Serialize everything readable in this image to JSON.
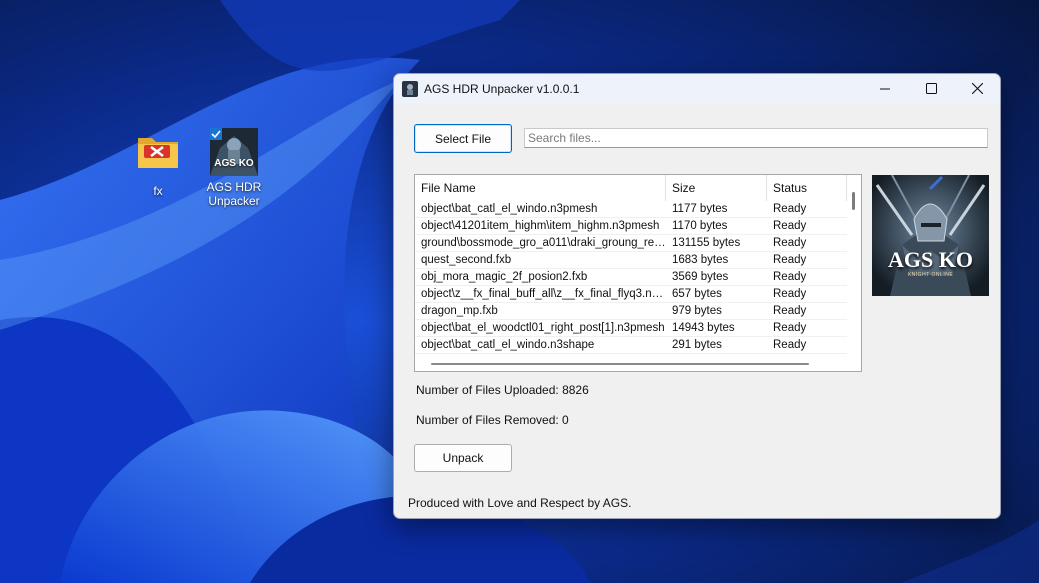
{
  "desktop": {
    "icons": [
      {
        "label": "fx"
      },
      {
        "label": "AGS HDR Unpacker"
      }
    ]
  },
  "window": {
    "title": "AGS HDR Unpacker v1.0.0.1",
    "controls": {
      "minimize": "minimize-icon",
      "maximize": "maximize-icon",
      "close": "close-icon"
    }
  },
  "toolbar": {
    "select_file_label": "Select File",
    "search_placeholder": "Search files..."
  },
  "table": {
    "columns": [
      "File Name",
      "Size",
      "Status"
    ],
    "rows": [
      {
        "name": "object\\bat_catl_el_windo.n3pmesh",
        "size": "1177 bytes",
        "status": "Ready"
      },
      {
        "name": "object\\41201item_highm\\item_highm.n3pmesh",
        "size": "1170 bytes",
        "status": "Ready"
      },
      {
        "name": "ground\\bossmode_gro_a011\\draki_groung_red_...",
        "size": "131155 bytes",
        "status": "Ready"
      },
      {
        "name": "quest_second.fxb",
        "size": "1683 bytes",
        "status": "Ready"
      },
      {
        "name": "obj_mora_magic_2f_posion2.fxb",
        "size": "3569 bytes",
        "status": "Ready"
      },
      {
        "name": "object\\z__fx_final_buff_all\\z__fx_final_flyq3.n3p...",
        "size": "657 bytes",
        "status": "Ready"
      },
      {
        "name": "dragon_mp.fxb",
        "size": "979 bytes",
        "status": "Ready"
      },
      {
        "name": "object\\bat_el_woodctl01_right_post[1].n3pmesh",
        "size": "14943 bytes",
        "status": "Ready"
      },
      {
        "name": "object\\bat_catl_el_windo.n3shape",
        "size": "291 bytes",
        "status": "Ready"
      }
    ]
  },
  "stats": {
    "uploaded_label": "Number of Files Uploaded: 8826",
    "removed_label": "Number of Files Removed: 0"
  },
  "actions": {
    "unpack_label": "Unpack"
  },
  "promo": {
    "logo_text": "AGS KO",
    "tagline": "KNIGHT ONLINE"
  },
  "footer": {
    "text": "Produced with Love and Respect by AGS."
  },
  "colors": {
    "accent": "#0067c0",
    "desktop_bg": "#0a1a4a",
    "window_bg": "#f0f0f0"
  }
}
